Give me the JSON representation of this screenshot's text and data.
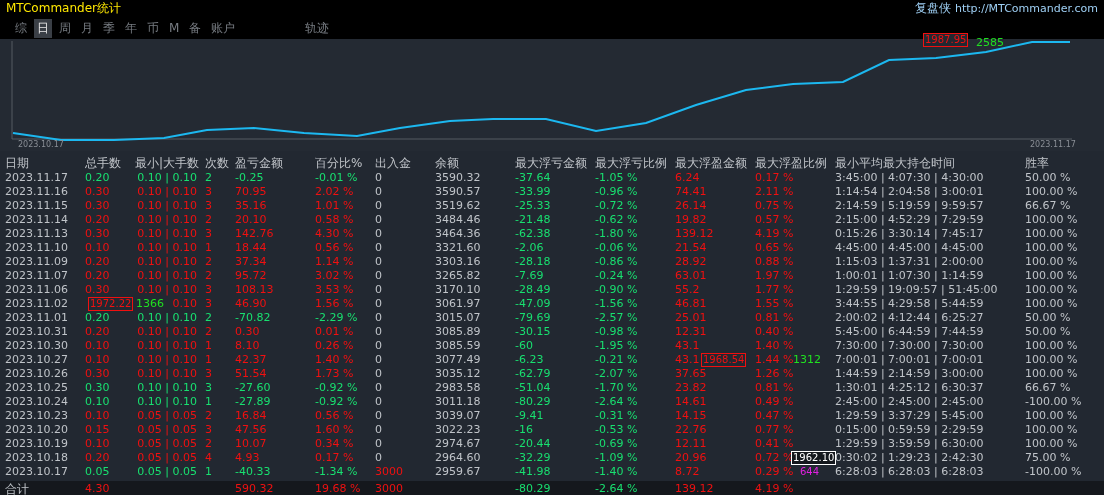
{
  "window": {
    "title": "MTCommander统计",
    "brand": "复盘侠",
    "url": "http://MTCommander.com"
  },
  "tabs": [
    {
      "label": "综",
      "selected": false
    },
    {
      "label": "日",
      "selected": true
    },
    {
      "label": "周",
      "selected": false
    },
    {
      "label": "月",
      "selected": false
    },
    {
      "label": "季",
      "selected": false
    },
    {
      "label": "年",
      "selected": false
    },
    {
      "label": "币",
      "selected": false
    },
    {
      "label": "M",
      "selected": false
    },
    {
      "label": "备",
      "selected": false
    },
    {
      "label": "账户",
      "selected": false
    },
    {
      "label": "轨迹",
      "selected": false
    }
  ],
  "chart": {
    "start_date": "2023.10.17",
    "end_date": "2023.11.17"
  },
  "markers": [
    {
      "price": "1987.95",
      "count": "2585",
      "kind": "sell"
    },
    {
      "price": "1972.22",
      "count": "1366",
      "kind": "sell"
    },
    {
      "price": "1968.54",
      "count": "1312",
      "kind": "sell"
    },
    {
      "price": "1962.10",
      "count": "644",
      "kind": "current"
    }
  ],
  "table": {
    "columns": [
      "日期",
      "总手数",
      "最小|大手数",
      "次数",
      "盈亏金额",
      "百分比%",
      "出入金",
      "余额",
      "最大浮亏金额",
      "最大浮亏比例",
      "最大浮盈金额",
      "最大浮盈比例",
      "最小平均最大持仓时间",
      "胜率"
    ],
    "rows": [
      {
        "loss": true,
        "deposit": false,
        "cells": [
          "2023.11.17",
          "0.20",
          "0.10 | 0.10",
          "2",
          "-0.25",
          "-0.01 %",
          "0",
          "3590.32",
          "-37.64",
          "-1.05 %",
          "6.24",
          "0.17 %",
          "3:45:00 | 4:07:30 | 4:30:00",
          "50.00 %"
        ]
      },
      {
        "loss": false,
        "deposit": false,
        "cells": [
          "2023.11.16",
          "0.30",
          "0.10 | 0.10",
          "3",
          "70.95",
          "2.02 %",
          "0",
          "3590.57",
          "-33.99",
          "-0.96 %",
          "74.41",
          "2.11 %",
          "1:14:54 | 2:04:58 | 3:00:01",
          "100.00 %"
        ]
      },
      {
        "loss": false,
        "deposit": false,
        "cells": [
          "2023.11.15",
          "0.30",
          "0.10 | 0.10",
          "3",
          "35.16",
          "1.01 %",
          "0",
          "3519.62",
          "-25.33",
          "-0.72 %",
          "26.14",
          "0.75 %",
          "2:14:59 | 5:19:59 | 9:59:57",
          "66.67 %"
        ]
      },
      {
        "loss": false,
        "deposit": false,
        "cells": [
          "2023.11.14",
          "0.20",
          "0.10 | 0.10",
          "2",
          "20.10",
          "0.58 %",
          "0",
          "3484.46",
          "-21.48",
          "-0.62 %",
          "19.82",
          "0.57 %",
          "2:15:00 | 4:52:29 | 7:29:59",
          "100.00 %"
        ]
      },
      {
        "loss": false,
        "deposit": false,
        "cells": [
          "2023.11.13",
          "0.30",
          "0.10 | 0.10",
          "3",
          "142.76",
          "4.30 %",
          "0",
          "3464.36",
          "-62.38",
          "-1.80 %",
          "139.12",
          "4.19 %",
          "0:15:26 | 3:30:14 | 7:45:17",
          "100.00 %"
        ]
      },
      {
        "loss": false,
        "deposit": false,
        "cells": [
          "2023.11.10",
          "0.10",
          "0.10 | 0.10",
          "1",
          "18.44",
          "0.56 %",
          "0",
          "3321.60",
          "-2.06",
          "-0.06 %",
          "21.54",
          "0.65 %",
          "4:45:00 | 4:45:00 | 4:45:00",
          "100.00 %"
        ]
      },
      {
        "loss": false,
        "deposit": false,
        "cells": [
          "2023.11.09",
          "0.20",
          "0.10 | 0.10",
          "2",
          "37.34",
          "1.14 %",
          "0",
          "3303.16",
          "-28.18",
          "-0.86 %",
          "28.92",
          "0.88 %",
          "1:15:03 | 1:37:31 | 2:00:00",
          "100.00 %"
        ]
      },
      {
        "loss": false,
        "deposit": false,
        "cells": [
          "2023.11.07",
          "0.20",
          "0.10 | 0.10",
          "2",
          "95.72",
          "3.02 %",
          "0",
          "3265.82",
          "-7.69",
          "-0.24 %",
          "63.01",
          "1.97 %",
          "1:00:01 | 1:07:30 | 1:14:59",
          "100.00 %"
        ]
      },
      {
        "loss": false,
        "deposit": false,
        "cells": [
          "2023.11.06",
          "0.30",
          "0.10 | 0.10",
          "3",
          "108.13",
          "3.53 %",
          "0",
          "3170.10",
          "-28.49",
          "-0.90 %",
          "55.2",
          "1.77 %",
          "1:29:59 | 19:09:57 | 51:45:00",
          "100.00 %"
        ]
      },
      {
        "loss": false,
        "deposit": false,
        "cells": [
          "2023.11.02",
          null,
          "0.10",
          "3",
          "46.90",
          "1.56 %",
          "0",
          "3061.97",
          "-47.09",
          "-1.56 %",
          "46.81",
          "1.55 %",
          "3:44:55 | 4:29:58 | 5:44:59",
          "100.00 %"
        ]
      },
      {
        "loss": true,
        "deposit": false,
        "cells": [
          "2023.11.01",
          "0.20",
          "0.10 | 0.10",
          "2",
          "-70.82",
          "-2.29 %",
          "0",
          "3015.07",
          "-79.69",
          "-2.57 %",
          "25.01",
          "0.81 %",
          "2:00:02 | 4:12:44 | 6:25:27",
          "50.00 %"
        ]
      },
      {
        "loss": false,
        "deposit": false,
        "cells": [
          "2023.10.31",
          "0.20",
          "0.10 | 0.10",
          "2",
          "0.30",
          "0.01 %",
          "0",
          "3085.89",
          "-30.15",
          "-0.98 %",
          "12.31",
          "0.40 %",
          "5:45:00 | 6:44:59 | 7:44:59",
          "50.00 %"
        ]
      },
      {
        "loss": false,
        "deposit": false,
        "cells": [
          "2023.10.30",
          "0.10",
          "0.10 | 0.10",
          "1",
          "8.10",
          "0.26 %",
          "0",
          "3085.59",
          "-60",
          "-1.95 %",
          "43.1",
          "1.40 %",
          "7:30:00 | 7:30:00 | 7:30:00",
          "100.00 %"
        ]
      },
      {
        "loss": false,
        "deposit": false,
        "cells": [
          "2023.10.27",
          "0.10",
          "0.10 | 0.10",
          "1",
          "42.37",
          "1.40 %",
          "0",
          "3077.49",
          "-6.23",
          "-0.21 %",
          "43.1",
          "1.44 %",
          "7:00:01 | 7:00:01 | 7:00:01",
          "100.00 %"
        ]
      },
      {
        "loss": false,
        "deposit": false,
        "cells": [
          "2023.10.26",
          "0.30",
          "0.10 | 0.10",
          "3",
          "51.54",
          "1.73 %",
          "0",
          "3035.12",
          "-62.79",
          "-2.07 %",
          "37.65",
          "1.26 %",
          "1:44:59 | 2:14:59 | 3:00:00",
          "100.00 %"
        ]
      },
      {
        "loss": true,
        "deposit": false,
        "cells": [
          "2023.10.25",
          "0.30",
          "0.10 | 0.10",
          "3",
          "-27.60",
          "-0.92 %",
          "0",
          "2983.58",
          "-51.04",
          "-1.70 %",
          "23.82",
          "0.81 %",
          "1:30:01 | 4:25:12 | 6:30:37",
          "66.67 %"
        ]
      },
      {
        "loss": true,
        "deposit": false,
        "cells": [
          "2023.10.24",
          "0.10",
          "0.10 | 0.10",
          "1",
          "-27.89",
          "-0.92 %",
          "0",
          "3011.18",
          "-80.29",
          "-2.64 %",
          "14.61",
          "0.49 %",
          "2:45:00 | 2:45:00 | 2:45:00",
          "-100.00 %"
        ]
      },
      {
        "loss": false,
        "deposit": false,
        "cells": [
          "2023.10.23",
          "0.10",
          "0.05 | 0.05",
          "2",
          "16.84",
          "0.56 %",
          "0",
          "3039.07",
          "-9.41",
          "-0.31 %",
          "14.15",
          "0.47 %",
          "1:29:59 | 3:37:29 | 5:45:00",
          "100.00 %"
        ]
      },
      {
        "loss": false,
        "deposit": false,
        "cells": [
          "2023.10.20",
          "0.15",
          "0.05 | 0.05",
          "3",
          "47.56",
          "1.60 %",
          "0",
          "3022.23",
          "-16",
          "-0.53 %",
          "22.76",
          "0.77 %",
          "0:15:00 | 0:59:59 | 2:29:59",
          "100.00 %"
        ]
      },
      {
        "loss": false,
        "deposit": false,
        "cells": [
          "2023.10.19",
          "0.10",
          "0.05 | 0.05",
          "2",
          "10.07",
          "0.34 %",
          "0",
          "2974.67",
          "-20.44",
          "-0.69 %",
          "12.11",
          "0.41 %",
          "1:29:59 | 3:59:59 | 6:30:00",
          "100.00 %"
        ]
      },
      {
        "loss": false,
        "deposit": false,
        "cells": [
          "2023.10.18",
          "0.20",
          "0.05 | 0.05",
          "4",
          "4.93",
          "0.17 %",
          "0",
          "2964.60",
          "-32.29",
          "-1.09 %",
          "20.96",
          "0.72 %",
          "0:30:02 | 1:29:23 | 2:42:30",
          "75.00 %"
        ]
      },
      {
        "loss": true,
        "deposit": true,
        "cells": [
          "2023.10.17",
          "0.05",
          "0.05 | 0.05",
          "1",
          "-40.33",
          "-1.34 %",
          "3000",
          "2959.67",
          "-41.98",
          "-1.40 %",
          "8.72",
          "0.29 %",
          "6:28:03 | 6:28:03 | 6:28:03",
          "-100.00 %"
        ]
      }
    ],
    "total": [
      "合计",
      "4.30",
      "590.32",
      "19.68 %",
      "3000",
      "-80.29",
      "-2.64 %",
      "139.12",
      "4.19 %"
    ]
  }
}
